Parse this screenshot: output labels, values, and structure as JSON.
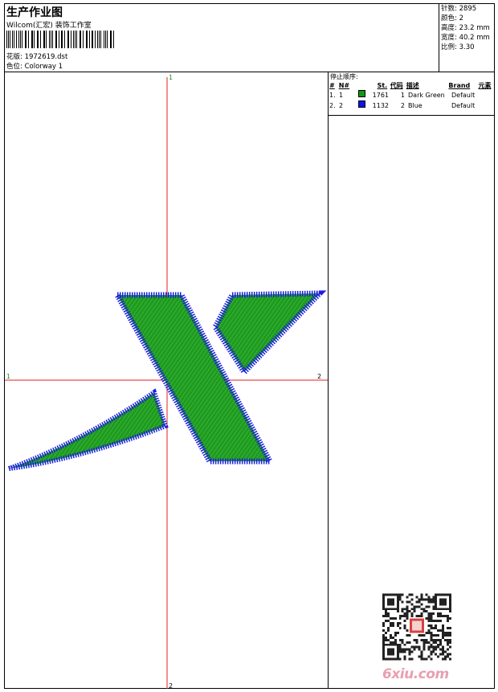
{
  "header": {
    "title": "生产作业图",
    "subtitle": "Wilcom(汇宏) 装饰工作室",
    "design_label": "花版:",
    "design_value": "1972619.dst",
    "colorway_label": "色位:",
    "colorway_value": "Colorway 1"
  },
  "stats": [
    {
      "label": "针数:",
      "value": "2895"
    },
    {
      "label": "颜色:",
      "value": "2"
    },
    {
      "label": "高度:",
      "value": "23.2 mm"
    },
    {
      "label": "宽度:",
      "value": "40.2 mm"
    },
    {
      "label": "比例:",
      "value": "3.30"
    }
  ],
  "axis_labels": {
    "top": "1",
    "bottom": "2",
    "left": "1",
    "right": "2"
  },
  "sequence": {
    "title": "停止顺序:",
    "columns": [
      "#",
      "N#",
      "St.",
      "代码",
      "描述",
      "Brand",
      "元素"
    ],
    "rows": [
      {
        "idx": "1.",
        "n": "1",
        "color": "#119911",
        "st": "1761",
        "code": "1",
        "desc": "Dark Green",
        "brand": "Default"
      },
      {
        "idx": "2.",
        "n": "2",
        "color": "#1111ee",
        "st": "1132",
        "code": "2",
        "desc": "Blue",
        "brand": "Default"
      }
    ]
  },
  "watermark": "6xiu.com",
  "colors": {
    "fill": "#1a9a1a",
    "outline": "#1c1ce8",
    "axis": "#e02020"
  }
}
